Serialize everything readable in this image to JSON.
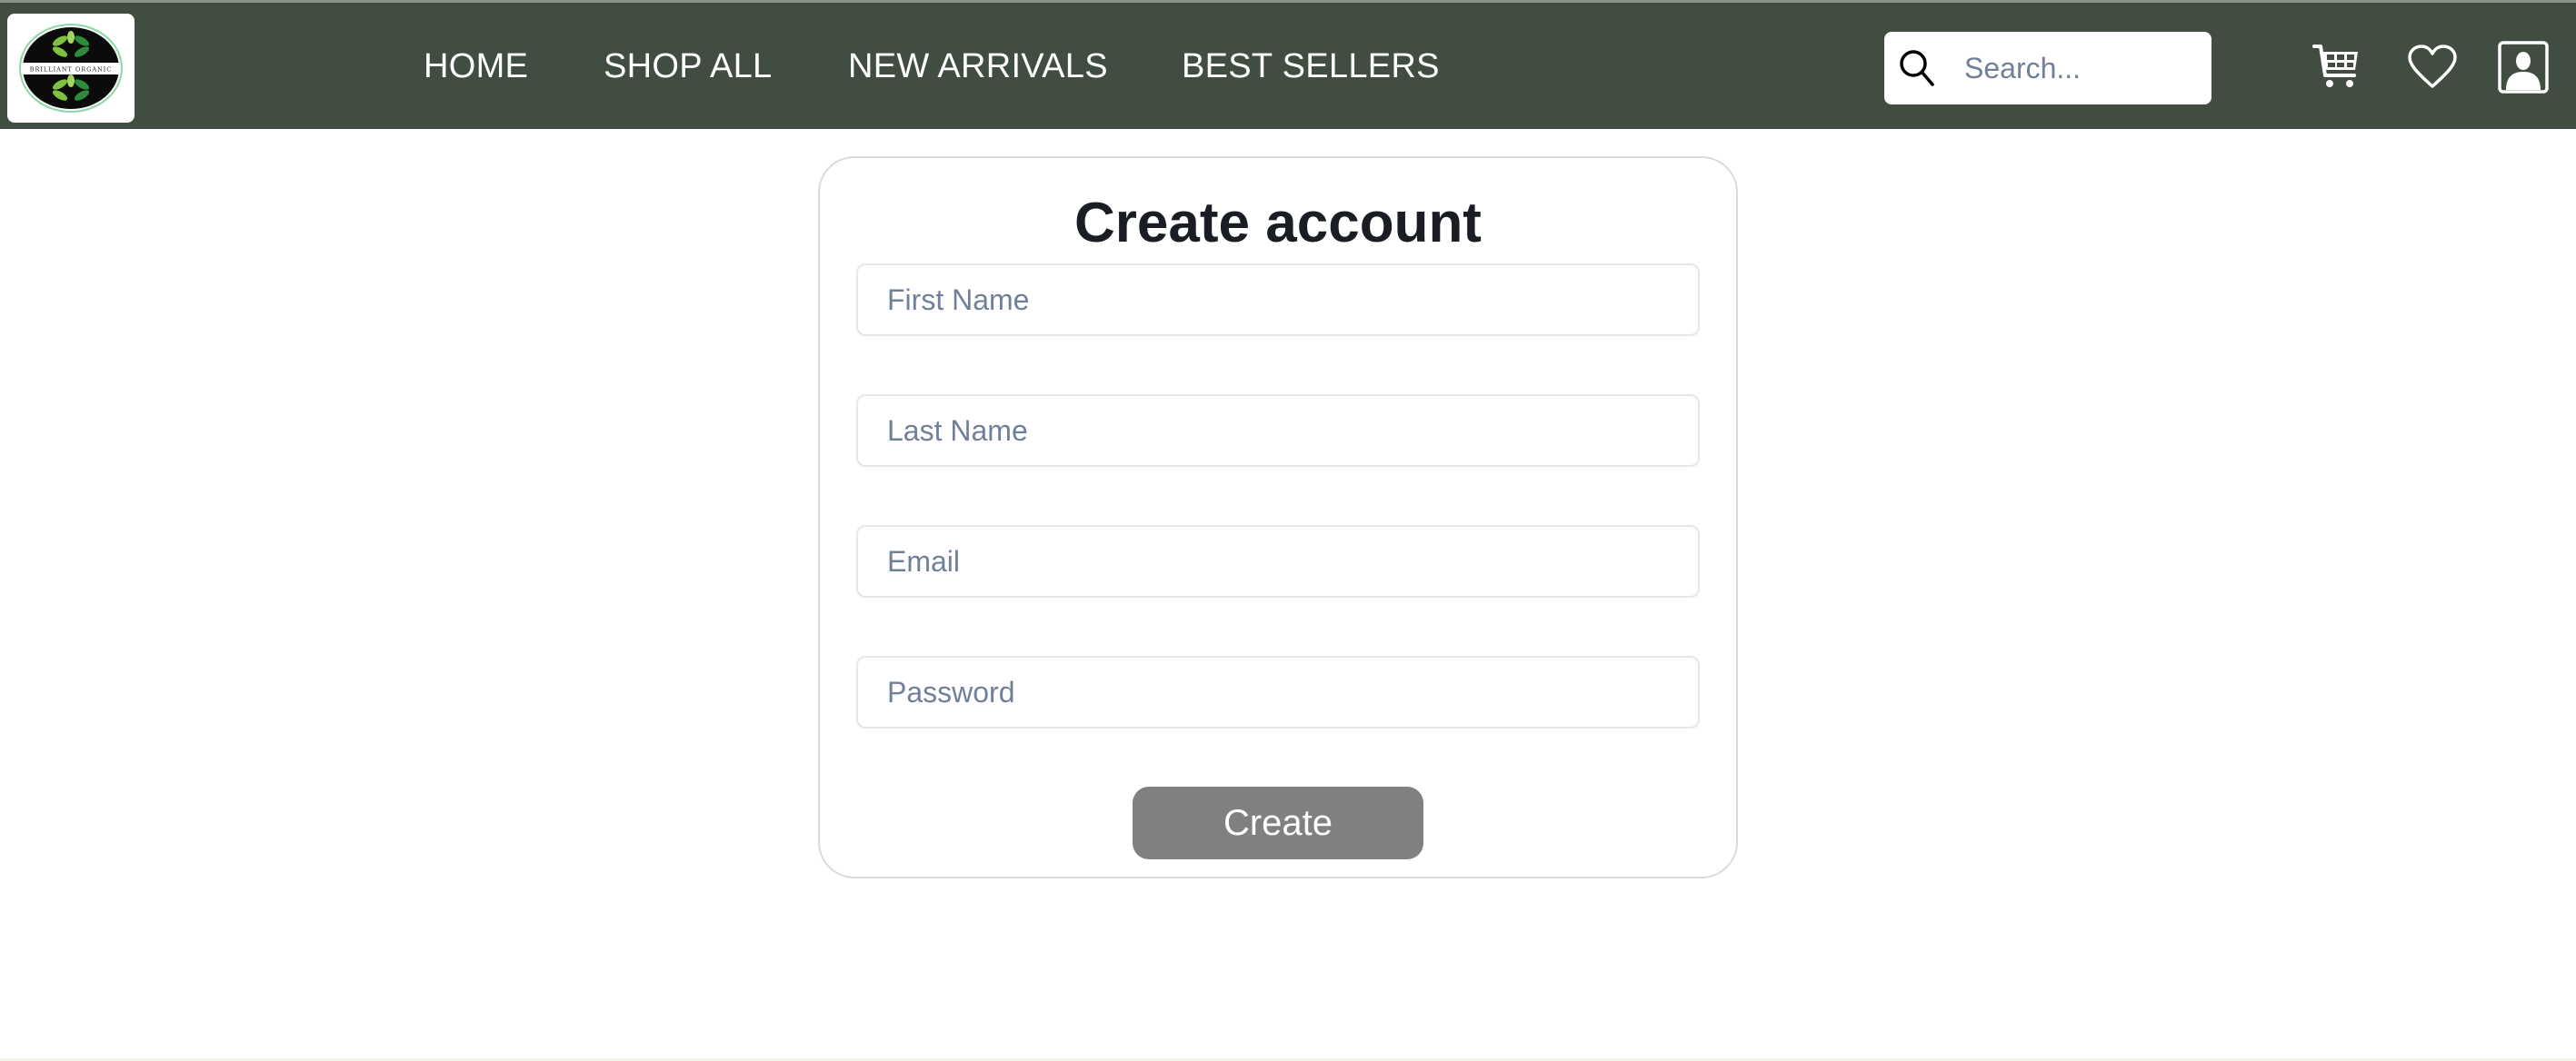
{
  "header": {
    "logo": {
      "text": "BRILLIANT ORGANIC",
      "alt": "Brilliant Organic logo"
    },
    "nav": [
      {
        "label": "HOME"
      },
      {
        "label": "SHOP ALL"
      },
      {
        "label": "NEW ARRIVALS"
      },
      {
        "label": "BEST SELLERS"
      }
    ],
    "search": {
      "placeholder": "Search...",
      "value": "",
      "icon": "search-icon"
    },
    "icons": [
      "cart-icon",
      "heart-icon",
      "user-profile-icon"
    ]
  },
  "form": {
    "title": "Create account",
    "fields": [
      {
        "name": "first-name",
        "placeholder": "First Name",
        "value": "",
        "type": "text"
      },
      {
        "name": "last-name",
        "placeholder": "Last Name",
        "value": "",
        "type": "text"
      },
      {
        "name": "email",
        "placeholder": "Email",
        "value": "",
        "type": "email"
      },
      {
        "name": "password",
        "placeholder": "Password",
        "value": "",
        "type": "password"
      }
    ],
    "submit_label": "Create"
  },
  "colors": {
    "header_bg": "#424d42",
    "button_bg": "#808080",
    "placeholder": "#71809a",
    "title": "#1a1d24",
    "logo_leaf_light": "#7dc242",
    "logo_leaf_dark": "#2e8b3a"
  }
}
